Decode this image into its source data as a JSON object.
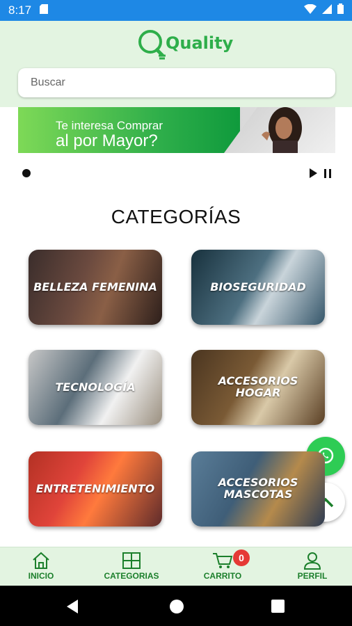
{
  "status": {
    "time": "8:17"
  },
  "app": {
    "logo_text": "Quality",
    "brand_color": "#2eae4a",
    "accent_header": "#e3f4e1"
  },
  "search": {
    "placeholder": "Buscar"
  },
  "banner": {
    "line1": "Te interesa Comprar",
    "line2": "al por Mayor?"
  },
  "section": {
    "title": "CATEGORÍAS"
  },
  "categories": [
    {
      "label": "BELLEZA FEMENINA"
    },
    {
      "label": "BIOSEGURIDAD"
    },
    {
      "label": "TECNOLOGÍA"
    },
    {
      "label": "ACCESORIOS HOGAR"
    },
    {
      "label": "ENTRETENIMIENTO"
    },
    {
      "label": "ACCESORIOS MASCOTAS"
    }
  ],
  "nav": {
    "home": "INICIO",
    "categories": "CATEGORIAS",
    "cart": "CARRITO",
    "profile": "PERFIL",
    "cart_count": "0"
  },
  "icons": [
    "whatsapp-icon",
    "chevron-up-icon",
    "home-icon",
    "grid-icon",
    "cart-icon",
    "person-icon"
  ]
}
